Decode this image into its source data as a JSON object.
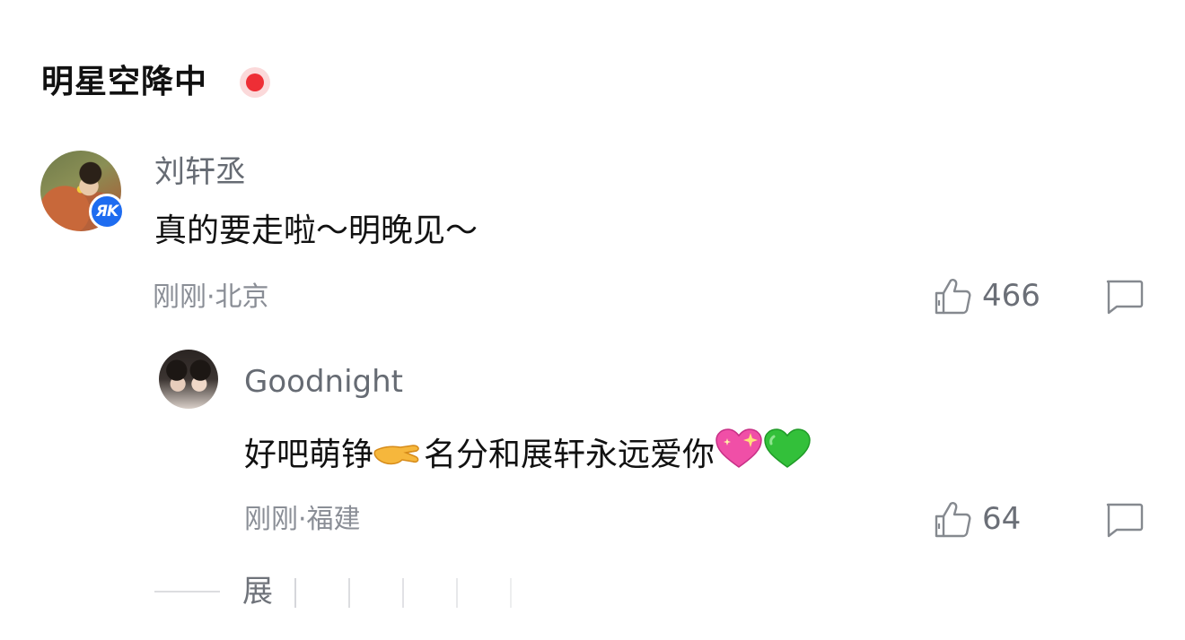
{
  "section": {
    "title": "明星空降中"
  },
  "comment": {
    "avatar_badge": "ЯK",
    "username": "刘轩丞",
    "text": "真的要走啦～明晚见～",
    "meta": "刚刚·北京",
    "likes": "466"
  },
  "reply": {
    "username": "Goodnight",
    "text_part1": "好吧萌铮",
    "text_part2": "名分和展轩永远爱你",
    "emojis": [
      "pinching-hand",
      "sparkling-heart",
      "green-heart"
    ],
    "meta": "刚刚·福建",
    "likes": "64"
  },
  "more": {
    "label": "展"
  },
  "colors": {
    "live_dot": "#ee2e35",
    "badge_blue": "#1e6cf0",
    "meta_gray": "#8a8e96"
  }
}
